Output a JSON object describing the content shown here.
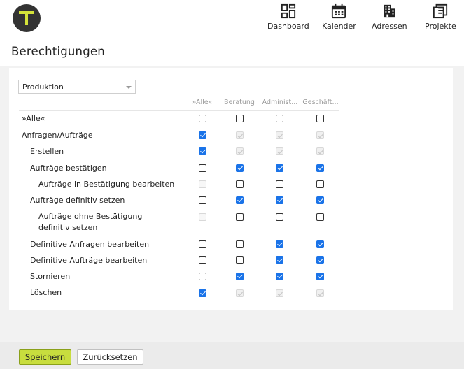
{
  "app": {
    "logo_icon": "t-logo-icon",
    "logo_bg": "#333333",
    "logo_accent": "#d4e23a"
  },
  "nav": [
    {
      "label": "Dashboard",
      "icon": "dashboard-icon"
    },
    {
      "label": "Kalender",
      "icon": "calendar-icon"
    },
    {
      "label": "Adressen",
      "icon": "building-icon"
    },
    {
      "label": "Projekte",
      "icon": "projects-icon"
    }
  ],
  "page": {
    "title": "Berechtigungen"
  },
  "role_select": {
    "value": "Produktion"
  },
  "columns": [
    "»Alle«",
    "Beratung",
    "Administ...",
    "Geschäft..."
  ],
  "rows": [
    {
      "label": "»Alle«",
      "states": [
        "off",
        "off",
        "off",
        "off"
      ]
    },
    {
      "label": "Anfragen/Aufträge",
      "states": [
        "on",
        "dis-on",
        "dis-on",
        "dis-on"
      ]
    },
    {
      "label": "Erstellen",
      "states": [
        "on",
        "dis-on",
        "dis-on",
        "dis-on"
      ]
    },
    {
      "label": "Aufträge bestätigen",
      "states": [
        "off",
        "on",
        "on",
        "on"
      ]
    },
    {
      "label": "Aufträge in Bestätigung bearbeiten",
      "states": [
        "dis-off",
        "off",
        "off",
        "off"
      ]
    },
    {
      "label": "Aufträge definitiv setzen",
      "states": [
        "off",
        "on",
        "on",
        "on"
      ]
    },
    {
      "label_line1": "Aufträge ohne Bestätigung",
      "label_line2": "definitiv setzen",
      "states": [
        "dis-off",
        "off",
        "off",
        "off"
      ]
    },
    {
      "label": "Definitive Anfragen bearbeiten",
      "states": [
        "off",
        "off",
        "on",
        "on"
      ]
    },
    {
      "label": "Definitive Aufträge bearbeiten",
      "states": [
        "off",
        "off",
        "on",
        "on"
      ]
    },
    {
      "label": "Stornieren",
      "states": [
        "off",
        "on",
        "on",
        "on"
      ]
    },
    {
      "label": "Löschen",
      "states": [
        "on",
        "dis-on",
        "dis-on",
        "dis-on"
      ]
    }
  ],
  "footer": {
    "save_label": "Speichern",
    "reset_label": "Zurücksetzen"
  },
  "colors": {
    "accent": "#c8dd3e",
    "checkbox_checked": "#1a73e8"
  }
}
